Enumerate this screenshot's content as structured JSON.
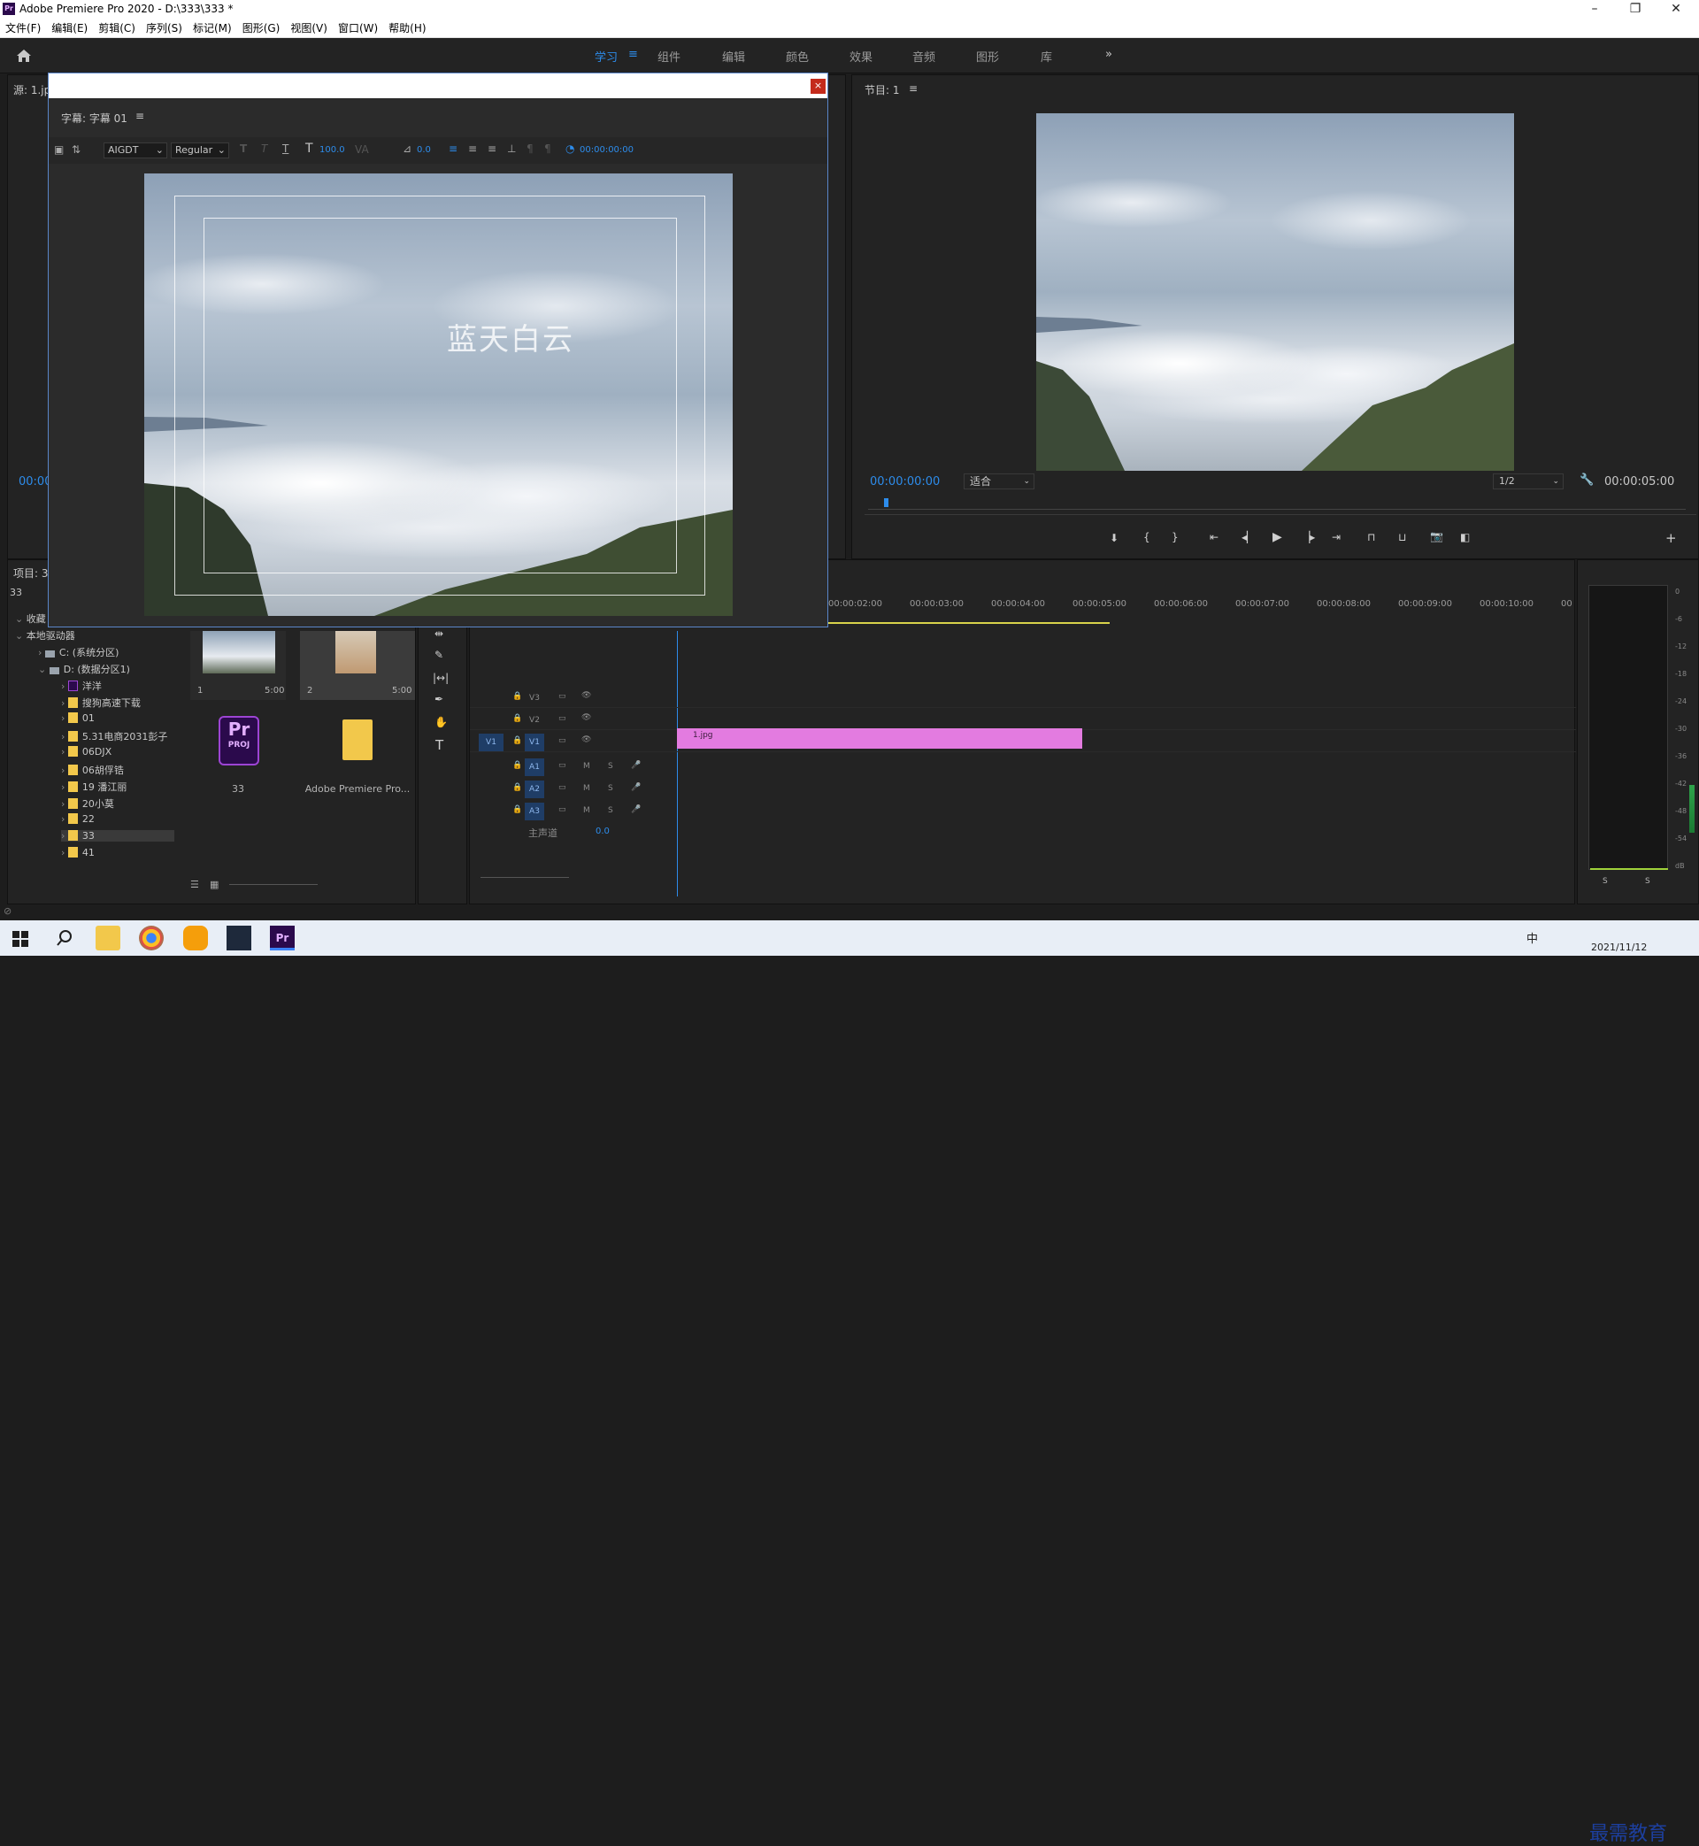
{
  "window": {
    "title": "Adobe Premiere Pro 2020 - D:\\333\\333 *",
    "app_badge": "Pr",
    "minimize": "–",
    "maximize": "❐",
    "close": "✕"
  },
  "menu": [
    "文件(F)",
    "编辑(E)",
    "剪辑(C)",
    "序列(S)",
    "标记(M)",
    "图形(G)",
    "视图(V)",
    "窗口(W)",
    "帮助(H)"
  ],
  "workspaces": {
    "items": [
      "学习",
      "组件",
      "编辑",
      "颜色",
      "效果",
      "音频",
      "图形",
      "库"
    ],
    "active": "学习",
    "more": "»"
  },
  "source_panel": {
    "title": "源: 1.jpg",
    "timecode": "00:00"
  },
  "title_dialog": {
    "close": "×",
    "header": "字幕: 字幕 01",
    "font": "AIGDT",
    "style": "Regular",
    "size": "100.0",
    "kerning": "0.0",
    "timecode": "00:00:00:00",
    "caption_text": "蓝天白云",
    "menu_glyph": "≡"
  },
  "program_monitor": {
    "title": "节目: 1",
    "timecode_current": "00:00:00:00",
    "zoom": "适合",
    "resolution": "1/2",
    "timecode_duration": "00:00:05:00"
  },
  "project_panel": {
    "title": "项目: 3",
    "search_value": "33",
    "tree": [
      {
        "label": "收藏",
        "level": 0,
        "type": "group"
      },
      {
        "label": "本地驱动器",
        "level": 0,
        "type": "group"
      },
      {
        "label": "C: (系统分区)",
        "level": 1,
        "type": "drive"
      },
      {
        "label": "D: (数据分区1)",
        "level": 1,
        "type": "drive"
      },
      {
        "label": "洋洋",
        "level": 2,
        "type": "pr"
      },
      {
        "label": "搜狗高速下载",
        "level": 2,
        "type": "folder"
      },
      {
        "label": "01",
        "level": 2,
        "type": "folder"
      },
      {
        "label": "5.31电商2031彭子",
        "level": 2,
        "type": "folder"
      },
      {
        "label": "06DJX",
        "level": 2,
        "type": "folder"
      },
      {
        "label": "06胡俘锆",
        "level": 2,
        "type": "folder"
      },
      {
        "label": "19 潘江丽",
        "level": 2,
        "type": "folder"
      },
      {
        "label": "20小莫",
        "level": 2,
        "type": "folder"
      },
      {
        "label": "22",
        "level": 2,
        "type": "folder"
      },
      {
        "label": "33",
        "level": 2,
        "type": "folder",
        "selected": true
      },
      {
        "label": "41",
        "level": 2,
        "type": "folder"
      }
    ],
    "thumbs": [
      {
        "index": "1",
        "duration": "5:00"
      },
      {
        "index": "2",
        "duration": "5:00"
      }
    ],
    "files": [
      {
        "name": "33",
        "badge": "Pr",
        "ext": "PROJ"
      },
      {
        "name": "Adobe Premiere Pro..."
      }
    ]
  },
  "timeline": {
    "ruler": [
      "00:00:02:00",
      "00:00:03:00",
      "00:00:04:00",
      "00:00:05:00",
      "00:00:06:00",
      "00:00:07:00",
      "00:00:08:00",
      "00:00:09:00",
      "00:00:10:00",
      "00"
    ],
    "video_tracks": [
      "V3",
      "V2",
      "V1"
    ],
    "audio_tracks": [
      "A1",
      "A2",
      "A3"
    ],
    "source_v1": "V1",
    "mute": "M",
    "solo": "S",
    "master_label": "主声道",
    "master_value": "0.0",
    "clip_name": "1.jpg"
  },
  "audio_meter": {
    "scale": [
      "0",
      "-6",
      "-12",
      "-18",
      "-24",
      "-30",
      "-36",
      "-42",
      "-48",
      "-54",
      "dB"
    ],
    "solo_left": "S",
    "solo_right": "S"
  },
  "taskbar": {
    "ime": "中",
    "clock_date": "2021/11/12",
    "watermark": "最需教育"
  },
  "colors": {
    "accent": "#2d8ceb",
    "clip": "#e37be0",
    "panel": "#232323"
  }
}
